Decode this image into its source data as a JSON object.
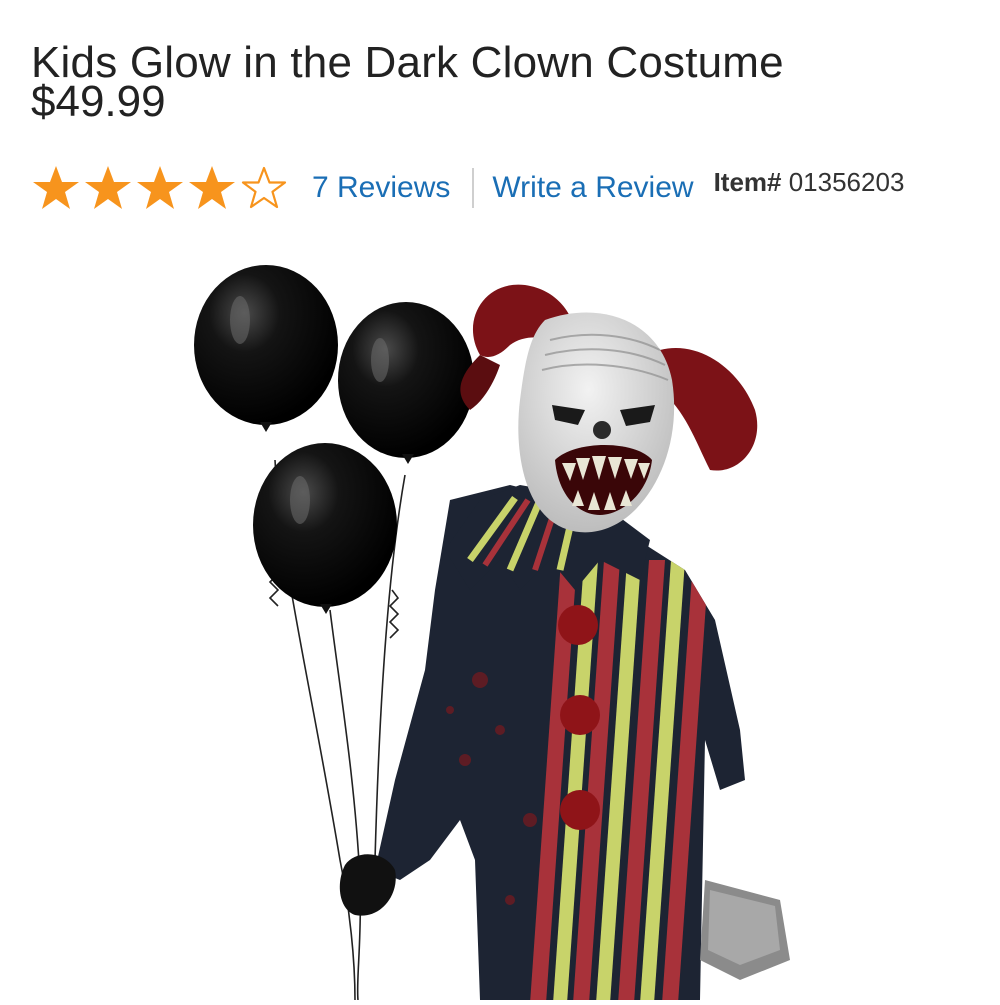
{
  "product": {
    "title": "Kids Glow in the Dark Clown Costume",
    "price": "$49.99",
    "rating": 4,
    "rating_max": 5,
    "reviews_label": "7 Reviews",
    "write_review_label": "Write a Review",
    "item_label": "Item#",
    "item_number": "01356203"
  },
  "colors": {
    "star": "#f7941d",
    "link": "#1a6eb5"
  },
  "image": {
    "icon": "clown-costume-product-image"
  }
}
